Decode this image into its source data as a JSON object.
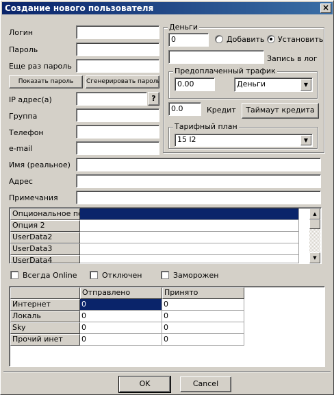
{
  "window": {
    "title": "Создание нового пользователя",
    "close_glyph": "×"
  },
  "form": {
    "login_label": "Логин",
    "password_label": "Пароль",
    "password_again_label": "Еще раз пароль",
    "show_password_button": "Показать пароль",
    "generate_password_button": "Сгенерировать пароль",
    "ip_label": "IP адрес(а)",
    "ip_help_button": "?",
    "group_label": "Группа",
    "phone_label": "Телефон",
    "email_label": "e-mail",
    "real_name_label": "Имя (реальное)",
    "address_label": "Адрес",
    "notes_label": "Примечания"
  },
  "money": {
    "group_title": "Деньги",
    "value": "0",
    "add_label": "Добавить",
    "set_label": "Установить",
    "selected_mode": "set",
    "log_label": "Запись в лог",
    "prepaid_title": "Предоплаченный трафик",
    "prepaid_value": "0.00",
    "prepaid_unit": "Деньги",
    "credit_value": "0.0",
    "credit_label": "Кредит",
    "credit_timeout_button": "Таймаут кредита",
    "tariff_title": "Тарифный план",
    "tariff_value": "15 l2"
  },
  "userdata": {
    "rows": [
      {
        "name": "Опциональное поле",
        "value": ""
      },
      {
        "name": "Опция 2",
        "value": ""
      },
      {
        "name": "UserData2",
        "value": ""
      },
      {
        "name": "UserData3",
        "value": ""
      },
      {
        "name": "UserData4",
        "value": ""
      }
    ]
  },
  "flags": {
    "always_online": "Всегда Online",
    "disabled": "Отключен",
    "frozen": "Заморожен"
  },
  "traffic": {
    "headers": [
      "",
      "Отправлено",
      "Принято"
    ],
    "rows": [
      {
        "name": "Интернет",
        "sent": "0",
        "received": "0"
      },
      {
        "name": "Локаль",
        "sent": "0",
        "received": "0"
      },
      {
        "name": "Sky",
        "sent": "0",
        "received": "0"
      },
      {
        "name": "Прочий инет",
        "sent": "0",
        "received": "0"
      }
    ]
  },
  "buttons": {
    "ok": "OK",
    "cancel": "Cancel"
  }
}
